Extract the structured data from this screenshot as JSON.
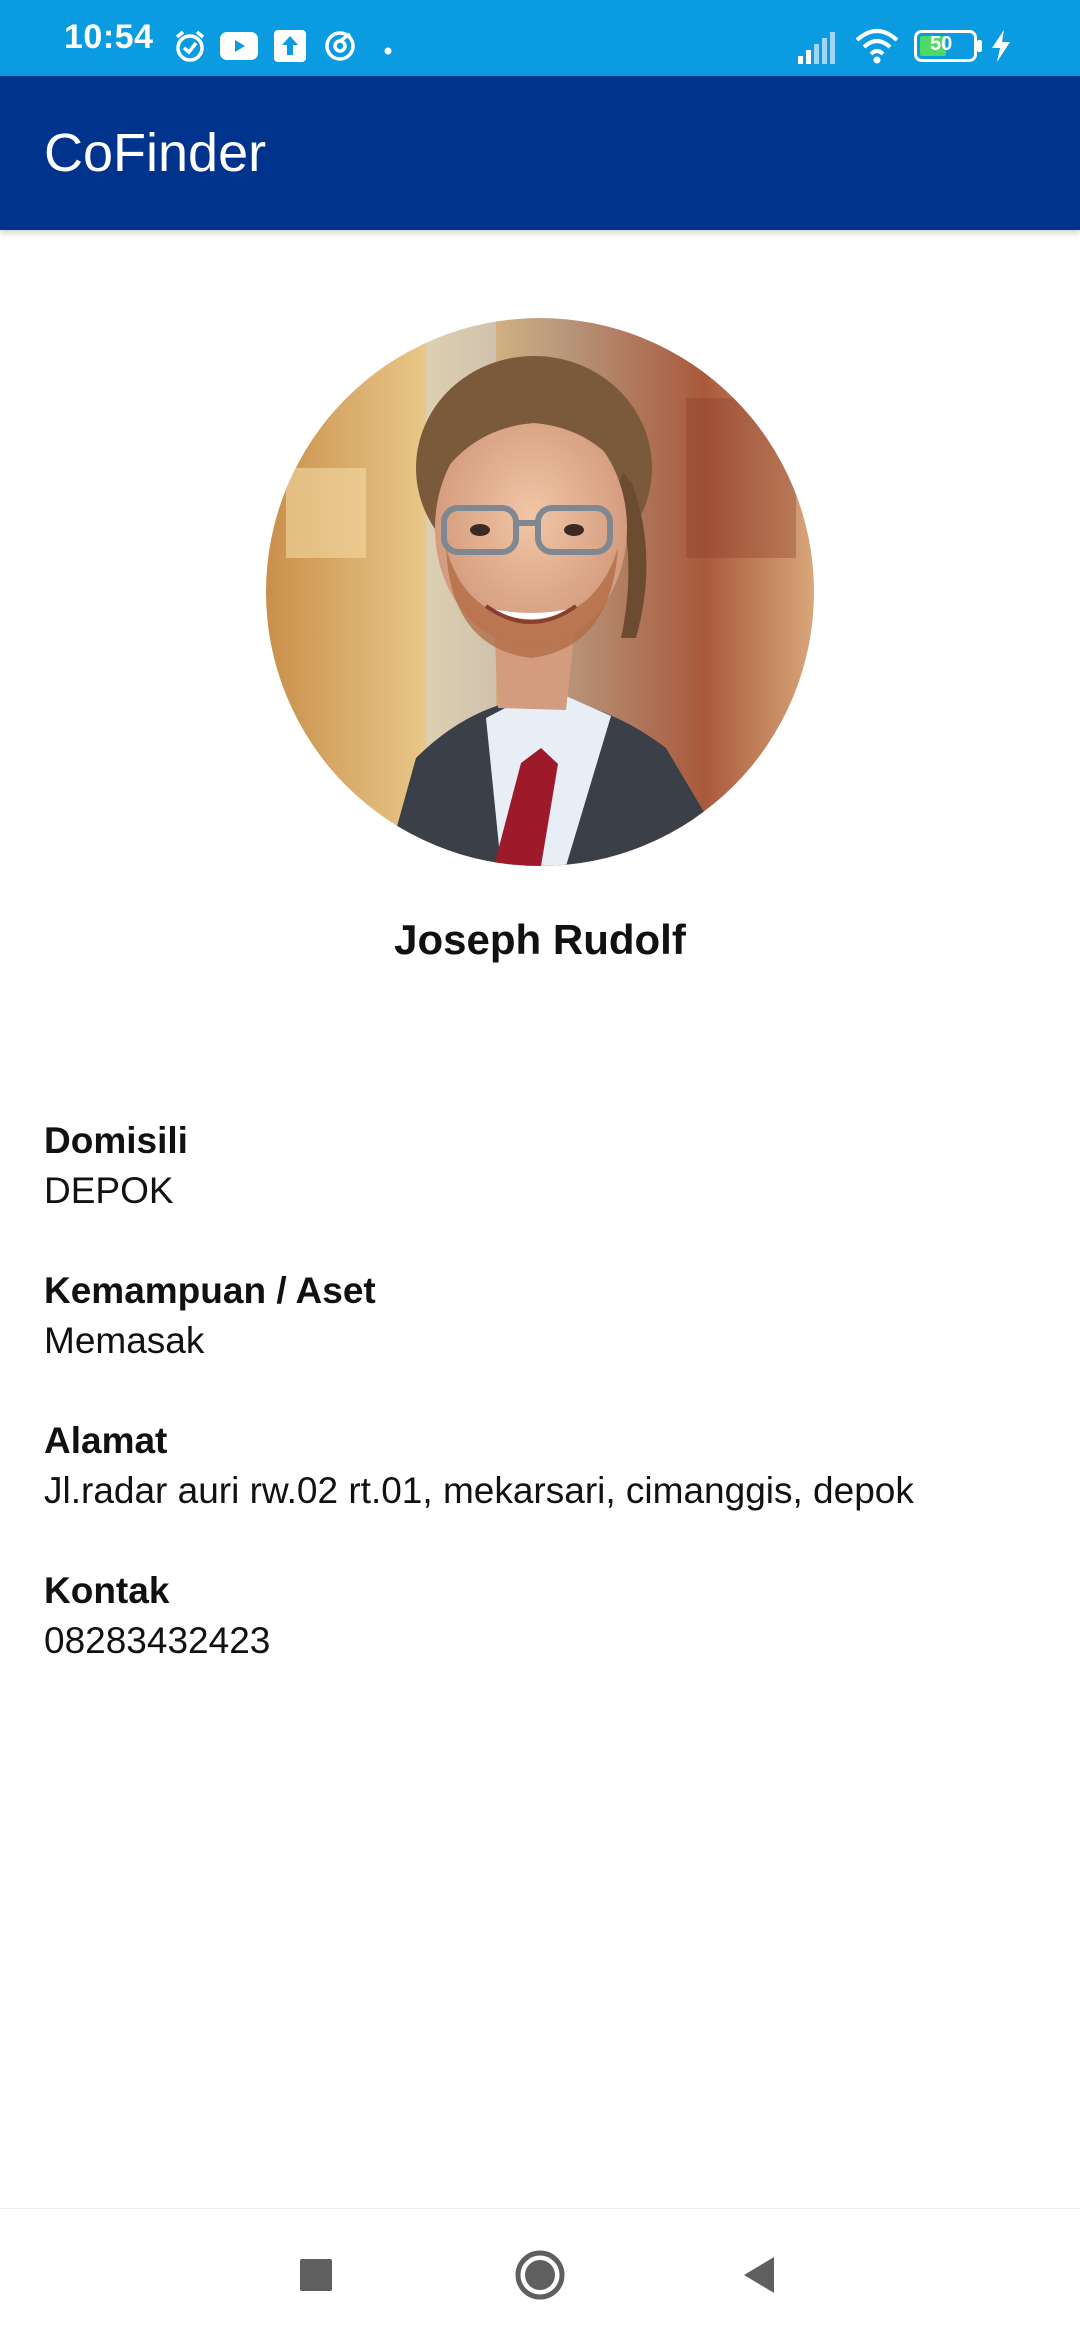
{
  "status_bar": {
    "time": "10:54",
    "battery_level": "50",
    "icons": [
      "alarm-icon",
      "youtube-icon",
      "upload-icon",
      "sync-icon",
      "dot-icon",
      "signal-icon",
      "wifi-icon",
      "battery-icon",
      "charging-icon"
    ],
    "background_color": "#0b9be0"
  },
  "app_bar": {
    "title": "CoFinder",
    "background_color": "#00338c"
  },
  "profile": {
    "name": "Joseph Rudolf"
  },
  "details": [
    {
      "label": "Domisili",
      "value": "DEPOK"
    },
    {
      "label": "Kemampuan / Aset",
      "value": "Memasak"
    },
    {
      "label": "Alamat",
      "value": "Jl.radar auri rw.02 rt.01, mekarsari, cimanggis, depok"
    },
    {
      "label": "Kontak",
      "value": "08283432423"
    }
  ],
  "nav_bar": {
    "buttons": [
      "recents-button",
      "home-button",
      "back-button"
    ]
  }
}
